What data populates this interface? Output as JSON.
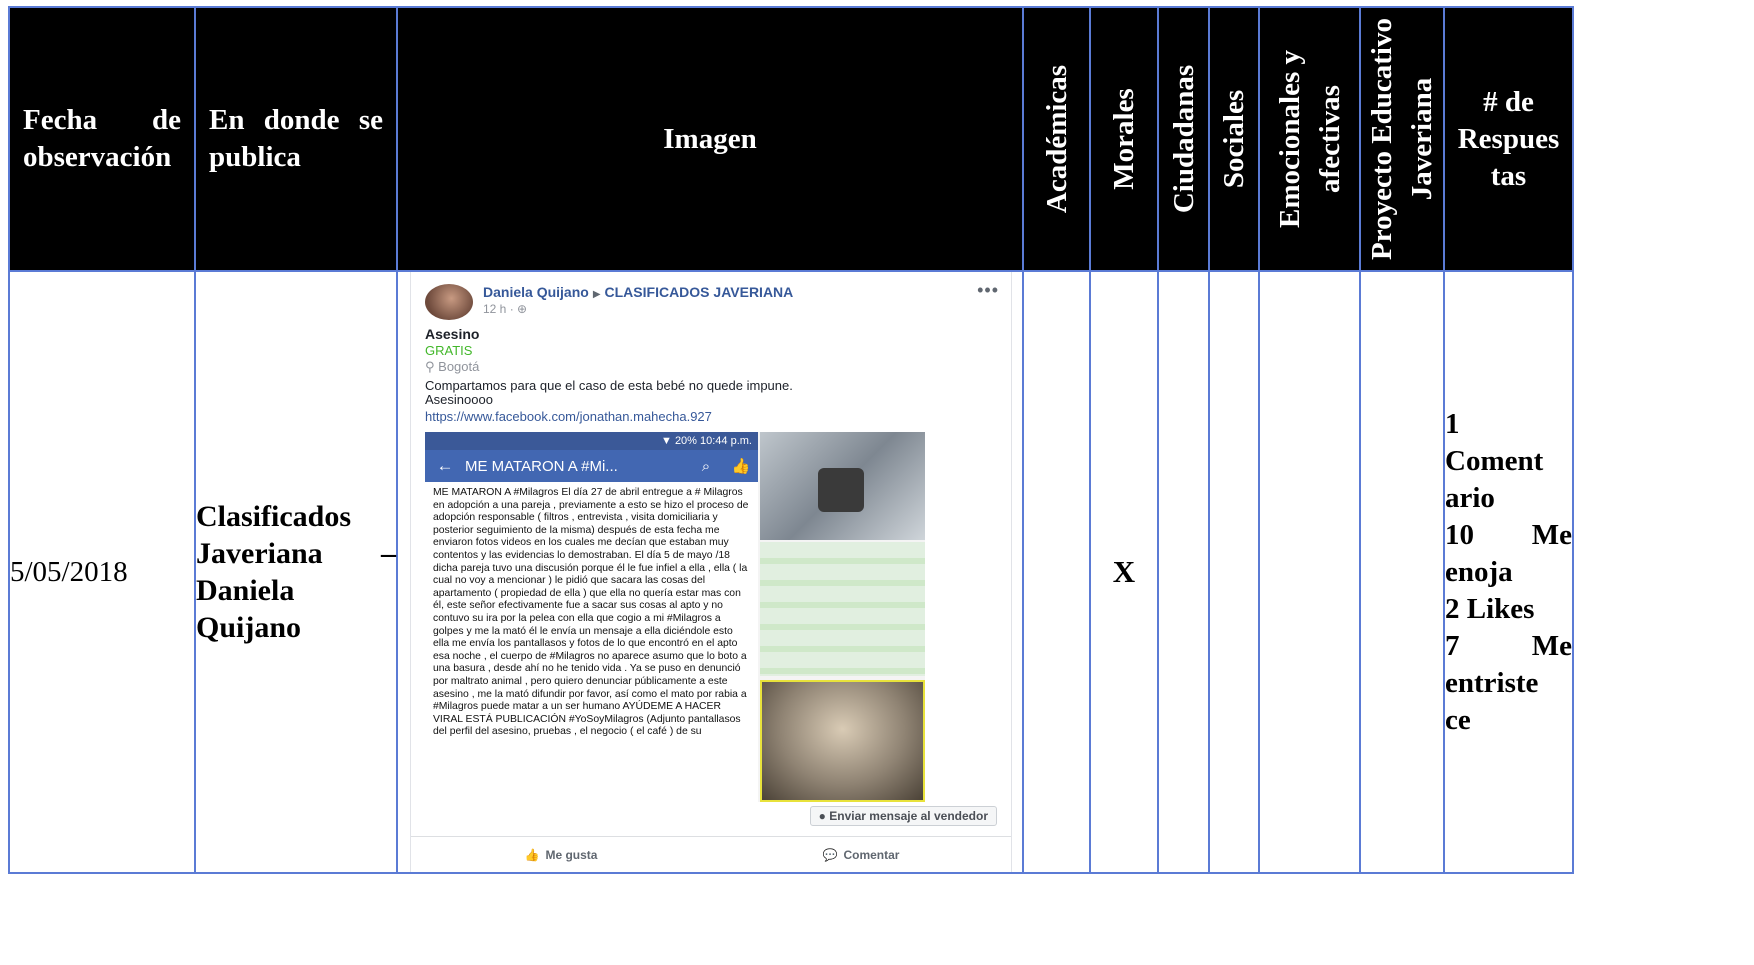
{
  "headers": {
    "fecha": "Fecha de observación",
    "lugar": "En donde se publica",
    "imagen": "Imagen",
    "academicas": "Académicas",
    "morales": "Morales",
    "ciudadanas": "Ciudadanas",
    "sociales": "Sociales",
    "emocionales_l1": "Emocionales y",
    "emocionales_l2": "afectivas",
    "proyecto_l1": "Proyecto Educativo",
    "proyecto_l2": "Javeriana",
    "respuestas_l1": "# de",
    "respuestas_l2": "Respues",
    "respuestas_l3": "tas"
  },
  "row": {
    "fecha": "5/05/2018",
    "lugar_l1": "Clasificados",
    "lugar_l2": "Javeriana –",
    "lugar_l3": "Daniela",
    "lugar_l4": "Quijano",
    "morales_mark": "X",
    "respuestas": [
      "1",
      "Coment",
      "ario",
      "10 Me",
      "enoja",
      "2 Likes",
      "7 Me",
      "entriste",
      "ce"
    ]
  },
  "post": {
    "author": "Daniela Quijano",
    "group": "CLASIFICADOS JAVERIANA",
    "time": "12 h ·",
    "title": "Asesino",
    "price": "GRATIS",
    "location": "Bogotá",
    "text_l1": "Compartamos para que el caso de esta bebé no quede impune.",
    "text_l2": "Asesinoooo",
    "link": "https://www.facebook.com/jonathan.mahecha.927",
    "phone_status": "20% 10:44 p.m.",
    "phone_title": "ME MATARON A #Mi...",
    "phone_text": "ME MATARON A #Milagros El día 27 de abril entregue a # Milagros en adopción a una pareja , previamente a esto se hizo el proceso de adopción responsable ( filtros , entrevista , visita domiciliaria y posterior seguimiento de la misma) después de esta fecha me enviaron fotos videos en los cuales me decían que estaban muy contentos y las evidencias lo demostraban. El día 5 de mayo /18 dicha pareja tuvo una discusión porque él le fue infiel a ella , ella ( la cual no voy a mencionar ) le pidió que sacara las cosas del apartamento ( propiedad de ella ) que ella no quería estar mas con él, este señor efectivamente fue a sacar sus cosas al apto y no contuvo su ira por la pelea con ella que cogio a mi #Milagros a golpes y me la mató él le envía un mensaje a ella diciéndole esto ella me envía los pantallasos y fotos de lo que encontró en el apto esa noche , el cuerpo de #Milagros no aparece asumo que lo boto a una basura , desde ahí no he tenido vida . Ya se puso en denunció por maltrato animal , pero quiero denunciar públicamente a este asesino , me la mató difundir por favor, así como el mato por rabia a #Milagros puede matar a un ser humano AYÚDEME A HACER VIRAL ESTÁ PUBLICACIÓN #YoSoyMilagros (Adjunto pantallasos del perfil del asesino, pruebas , el negocio ( el café ) de su",
    "message_button": "Enviar mensaje al vendedor",
    "like_label": "Me gusta",
    "comment_label": "Comentar"
  },
  "colors": {
    "header_bg": "#000000",
    "border": "#5b7bd5",
    "fb_blue": "#4267b2",
    "fb_link": "#365899",
    "fb_green": "#42b72a"
  }
}
